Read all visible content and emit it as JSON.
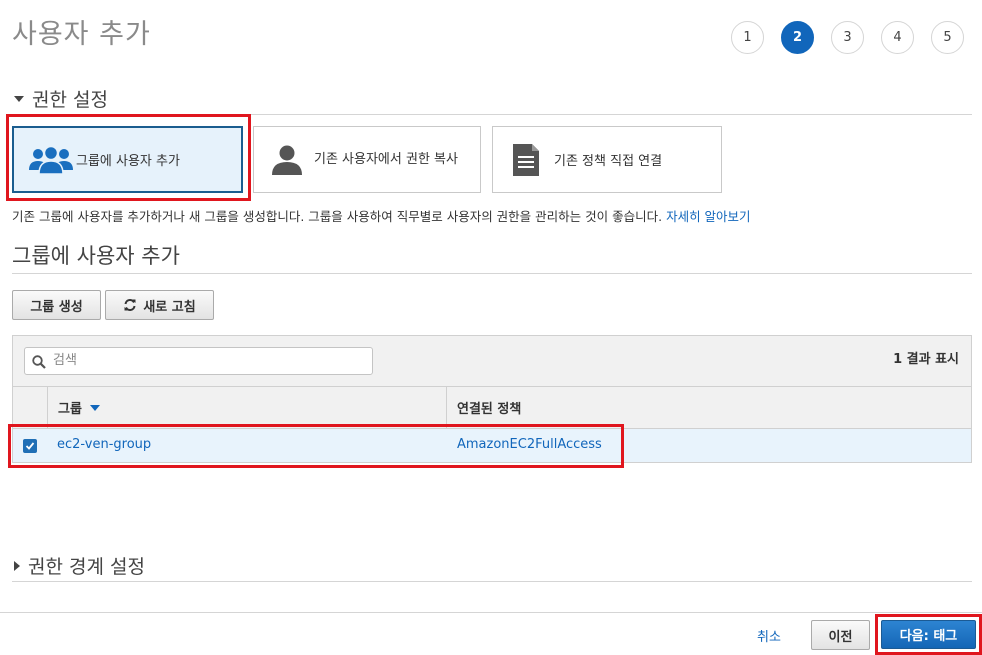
{
  "header": {
    "title": "사용자 추가",
    "steps": [
      "1",
      "2",
      "3",
      "4",
      "5"
    ],
    "active_step": "2"
  },
  "permissions": {
    "section_title": "권한 설정",
    "options": [
      {
        "label": "그룹에 사용자 추가",
        "icon": "users-group-icon",
        "selected": true
      },
      {
        "label": "기존 사용자에서 권한 복사",
        "icon": "user-icon",
        "selected": false
      },
      {
        "label": "기존 정책 직접 연결",
        "icon": "document-icon",
        "selected": false
      }
    ],
    "description": "기존 그룹에 사용자를 추가하거나 새 그룹을 생성합니다. 그룹을 사용하여 직무별로 사용자의 권한을 관리하는 것이 좋습니다.",
    "learn_more": "자세히 알아보기"
  },
  "group_section": {
    "title": "그룹에 사용자 추가",
    "create_group_label": "그룹 생성",
    "refresh_label": "새로 고침",
    "search_placeholder": "검색",
    "result_count": "1 결과 표시",
    "columns": [
      "그룹",
      "연결된 정책"
    ],
    "rows": [
      {
        "group": "ec2-ven-group",
        "policy": "AmazonEC2FullAccess",
        "checked": true
      }
    ]
  },
  "boundary": {
    "section_title": "권한 경계 설정"
  },
  "footer": {
    "cancel_label": "취소",
    "prev_label": "이전",
    "next_label": "다음: 태그"
  },
  "colors": {
    "accent": "#1166bb",
    "highlight": "#e0161e",
    "selected_bg": "#e6f2fb"
  }
}
